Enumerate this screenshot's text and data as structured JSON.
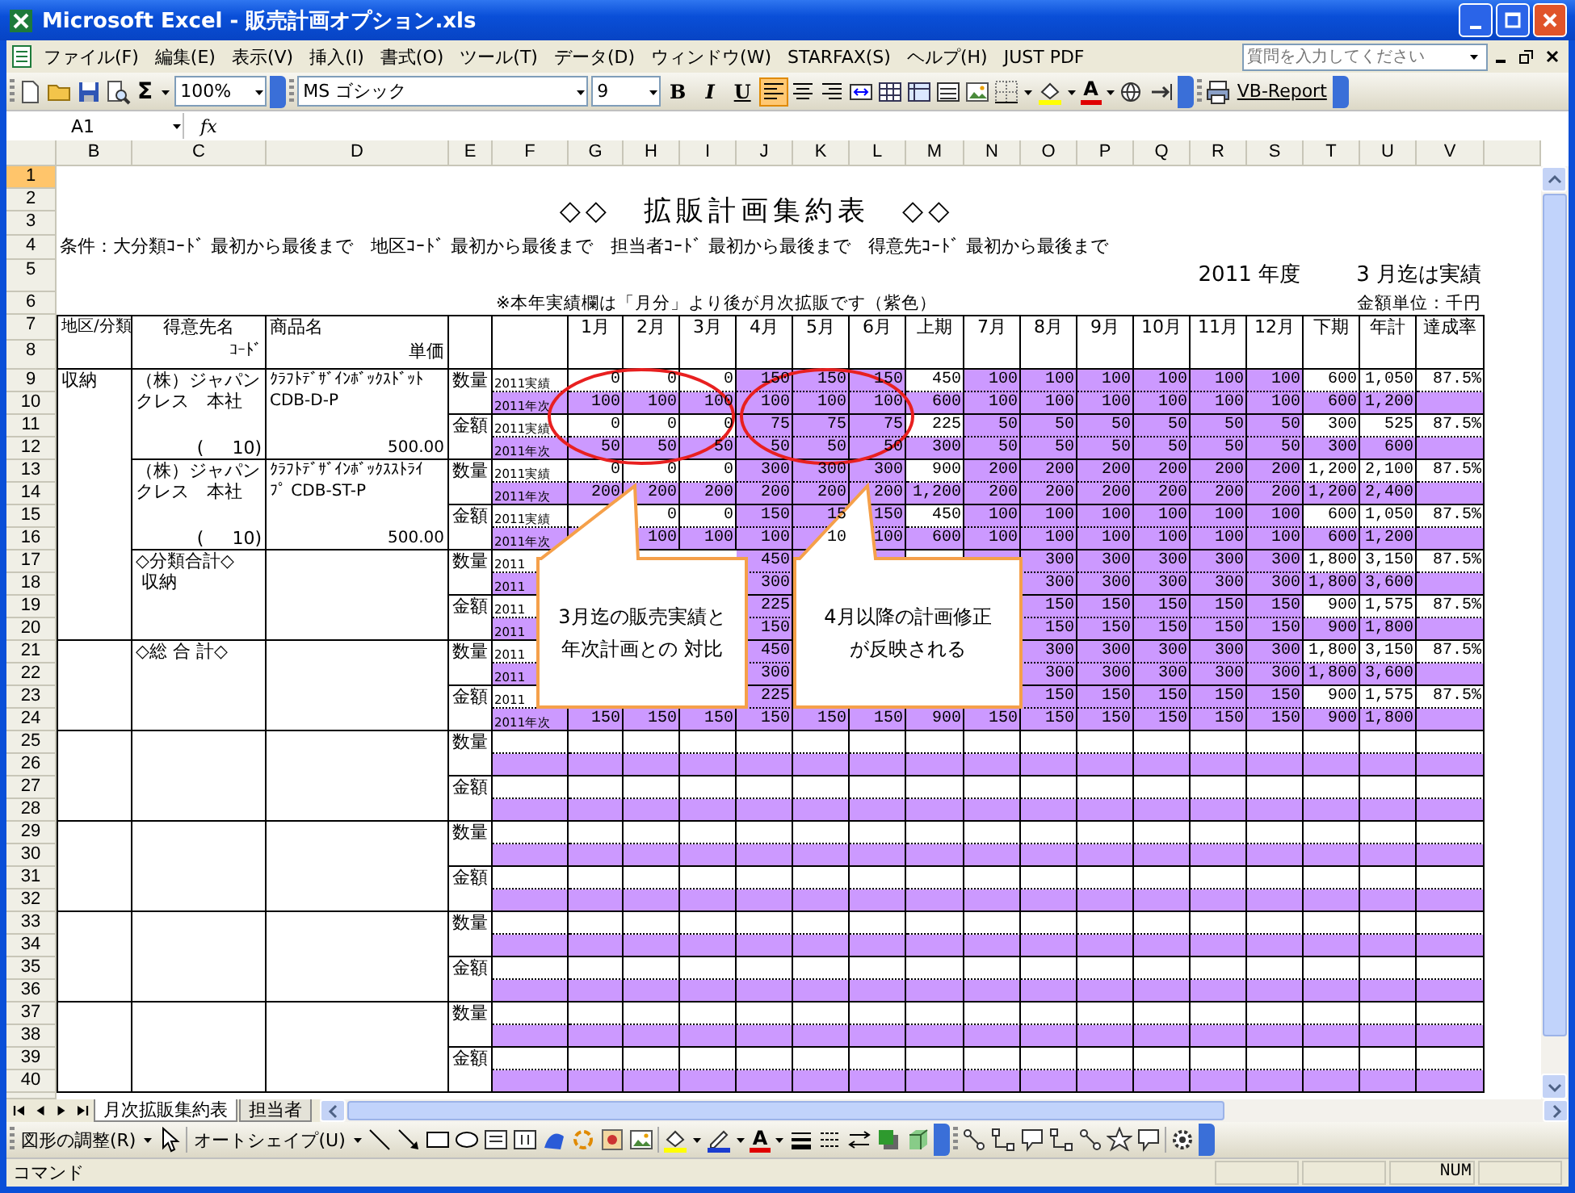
{
  "window": {
    "title": "Microsoft Excel - 販売計画オプション.xls"
  },
  "menu": [
    "ファイル(F)",
    "編集(E)",
    "表示(V)",
    "挿入(I)",
    "書式(O)",
    "ツール(T)",
    "データ(D)",
    "ウィンドウ(W)",
    "STARFAX(S)",
    "ヘルプ(H)",
    "JUST PDF"
  ],
  "help_search": {
    "placeholder": "質問を入力してください"
  },
  "toolbar": {
    "sum": "Σ",
    "zoom": "100%",
    "font": "MS ゴシック",
    "size": "9",
    "format_buttons": [
      "B",
      "I",
      "U"
    ],
    "align_buttons": [
      {
        "selected": true
      },
      {
        "selected": false
      },
      {
        "selected": false
      }
    ],
    "font_color": "A",
    "report_button": "VB-Report"
  },
  "formula_bar": {
    "name_box": "A1",
    "function_label": "fx"
  },
  "sheet": {
    "columns": [
      "B",
      "C",
      "D",
      "E",
      "F",
      "G",
      "H",
      "I",
      "J",
      "K",
      "L",
      "M",
      "N",
      "O",
      "P",
      "Q",
      "R",
      "S",
      "T",
      "U",
      "V"
    ],
    "rows": [
      {
        "label": "1",
        "selected": true
      },
      {
        "label": "2",
        "selected": false
      },
      {
        "label": "3",
        "selected": false
      },
      {
        "label": "4",
        "selected": false
      },
      {
        "label": "5",
        "selected": false
      },
      {
        "label": "6",
        "selected": false
      },
      {
        "label": "7",
        "selected": false
      },
      {
        "label": "8",
        "selected": false
      },
      {
        "label": "9",
        "selected": false
      },
      {
        "label": "10",
        "selected": false
      },
      {
        "label": "11",
        "selected": false
      },
      {
        "label": "12",
        "selected": false
      },
      {
        "label": "13",
        "selected": false
      },
      {
        "label": "14",
        "selected": false
      },
      {
        "label": "15",
        "selected": false
      },
      {
        "label": "16",
        "selected": false
      },
      {
        "label": "17",
        "selected": false
      },
      {
        "label": "18",
        "selected": false
      },
      {
        "label": "19",
        "selected": false
      },
      {
        "label": "20",
        "selected": false
      },
      {
        "label": "21",
        "selected": false
      },
      {
        "label": "22",
        "selected": false
      },
      {
        "label": "23",
        "selected": false
      },
      {
        "label": "24",
        "selected": false
      },
      {
        "label": "25",
        "selected": false
      },
      {
        "label": "26",
        "selected": false
      },
      {
        "label": "27",
        "selected": false
      },
      {
        "label": "28",
        "selected": false
      },
      {
        "label": "29",
        "selected": false
      },
      {
        "label": "30",
        "selected": false
      },
      {
        "label": "31",
        "selected": false
      },
      {
        "label": "32",
        "selected": false
      },
      {
        "label": "33",
        "selected": false
      },
      {
        "label": "34",
        "selected": false
      },
      {
        "label": "35",
        "selected": false
      },
      {
        "label": "36",
        "selected": false
      },
      {
        "label": "37",
        "selected": false
      },
      {
        "label": "38",
        "selected": false
      },
      {
        "label": "39",
        "selected": false
      },
      {
        "label": "40",
        "selected": false
      }
    ],
    "title": "◇◇　拡販計画集約表　◇◇",
    "conditions": "条件：大分類ｺｰﾄﾞ 最初から最後まで　地区ｺｰﾄﾞ 最初から最後まで　担当者ｺｰﾄﾞ 最初から最後まで　得意先ｺｰﾄﾞ 最初から最後まで",
    "fiscal_year": "2011 年度",
    "actual_until": "3 月迄は実績",
    "note": "※本年実績欄は「月分」より後が月次拡販です（紫色）",
    "unit": "金額単位：千円",
    "header": {
      "region": "地区/分類",
      "customer": "得意先名",
      "code": "ｺｰﾄﾞ",
      "product": "商品名",
      "price": "単価"
    },
    "months": [
      {
        "label": "1月",
        "forecast": false
      },
      {
        "label": "2月",
        "forecast": false
      },
      {
        "label": "3月",
        "forecast": false
      },
      {
        "label": "4月",
        "forecast": true
      },
      {
        "label": "5月",
        "forecast": true
      },
      {
        "label": "6月",
        "forecast": true
      },
      {
        "label": "上期",
        "forecast": false
      },
      {
        "label": "7月",
        "forecast": true
      },
      {
        "label": "8月",
        "forecast": true
      },
      {
        "label": "9月",
        "forecast": true
      },
      {
        "label": "10月",
        "forecast": true
      },
      {
        "label": "11月",
        "forecast": true
      },
      {
        "label": "12月",
        "forecast": true
      },
      {
        "label": "下期",
        "forecast": false
      },
      {
        "label": "年計",
        "forecast": false
      },
      {
        "label": "達成率",
        "forecast": false
      }
    ],
    "sections": [
      {
        "region": "収納",
        "groups": [
          {
            "customer": [
              "（株）ジャパン",
              "クレス　本社"
            ],
            "code": "(     10)",
            "product": [
              "ｸﾗﾌﾄﾃﾞｻﾞｲﾝﾎﾞｯｸｽﾄﾞｯﾄ",
              "CDB-D-P"
            ],
            "price": "500.00",
            "measures": [
              {
                "label": "数量",
                "rows": [
                  {
                    "kind": "actual",
                    "label": "2011実績",
                    "cells": [
                      "0",
                      "0",
                      "0",
                      "150",
                      "150",
                      "150",
                      "450",
                      "100",
                      "100",
                      "100",
                      "100",
                      "100",
                      "100",
                      "600",
                      "1,050",
                      "87.5%"
                    ]
                  },
                  {
                    "kind": "plan",
                    "label": "2011年次",
                    "cells": [
                      "100",
                      "100",
                      "100",
                      "100",
                      "100",
                      "100",
                      "600",
                      "100",
                      "100",
                      "100",
                      "100",
                      "100",
                      "100",
                      "600",
                      "1,200",
                      null
                    ]
                  }
                ]
              },
              {
                "label": "金額",
                "rows": [
                  {
                    "kind": "actual",
                    "label": "2011実績",
                    "cells": [
                      "0",
                      "0",
                      "0",
                      "75",
                      "75",
                      "75",
                      "225",
                      "50",
                      "50",
                      "50",
                      "50",
                      "50",
                      "50",
                      "300",
                      "525",
                      "87.5%"
                    ]
                  },
                  {
                    "kind": "plan",
                    "label": "2011年次",
                    "cells": [
                      "50",
                      "50",
                      "50",
                      "50",
                      "50",
                      "50",
                      "300",
                      "50",
                      "50",
                      "50",
                      "50",
                      "50",
                      "50",
                      "300",
                      "600",
                      null
                    ]
                  }
                ]
              }
            ]
          },
          {
            "customer": [
              "（株）ジャパン",
              "クレス　本社"
            ],
            "code": "(     10)",
            "product": [
              "ｸﾗﾌﾄﾃﾞｻﾞｲﾝﾎﾞｯｸｽｽﾄﾗｲ",
              "ﾌﾟ CDB-ST-P"
            ],
            "price": "500.00",
            "measures": [
              {
                "label": "数量",
                "rows": [
                  {
                    "kind": "actual",
                    "label": "2011実績",
                    "cells": [
                      "0",
                      "0",
                      "0",
                      "300",
                      "300",
                      "300",
                      "900",
                      "200",
                      "200",
                      "200",
                      "200",
                      "200",
                      "200",
                      "1,200",
                      "2,100",
                      "87.5%"
                    ]
                  },
                  {
                    "kind": "plan",
                    "label": "2011年次",
                    "cells": [
                      "200",
                      "200",
                      "200",
                      "200",
                      "200",
                      "200",
                      "1,200",
                      "200",
                      "200",
                      "200",
                      "200",
                      "200",
                      "200",
                      "1,200",
                      "2,400",
                      null
                    ]
                  }
                ]
              },
              {
                "label": "金額",
                "rows": [
                  {
                    "kind": "actual",
                    "label": "2011実績",
                    "cells": [
                      null,
                      "0",
                      "0",
                      "150",
                      "15",
                      "150",
                      "450",
                      "100",
                      "100",
                      "100",
                      "100",
                      "100",
                      "100",
                      "600",
                      "1,050",
                      "87.5%"
                    ]
                  },
                  {
                    "kind": "plan",
                    "label": "2011年次",
                    "cells": [
                      null,
                      "100",
                      "100",
                      "100",
                      "10",
                      "100",
                      "600",
                      "100",
                      "100",
                      "100",
                      "100",
                      "100",
                      "100",
                      "600",
                      "1,200",
                      null
                    ]
                  }
                ]
              }
            ]
          },
          {
            "customer": [
              "◇分類合計◇",
              " 収納"
            ],
            "measures": [
              {
                "label": "数量",
                "rows": [
                  {
                    "kind": "actual",
                    "label": "2011",
                    "cells": [
                      null,
                      null,
                      null,
                      "450",
                      null,
                      null,
                      null,
                      null,
                      "300",
                      "300",
                      "300",
                      "300",
                      "300",
                      "1,800",
                      "3,150",
                      "87.5%"
                    ]
                  },
                  {
                    "kind": "plan",
                    "label": "2011",
                    "cells": [
                      null,
                      null,
                      null,
                      "300",
                      null,
                      null,
                      null,
                      null,
                      "300",
                      "300",
                      "300",
                      "300",
                      "300",
                      "1,800",
                      "3,600",
                      null
                    ]
                  }
                ]
              },
              {
                "label": "金額",
                "rows": [
                  {
                    "kind": "actual",
                    "label": "2011",
                    "cells": [
                      null,
                      null,
                      null,
                      "225",
                      null,
                      null,
                      null,
                      null,
                      "150",
                      "150",
                      "150",
                      "150",
                      "150",
                      "900",
                      "1,575",
                      "87.5%"
                    ]
                  },
                  {
                    "kind": "plan",
                    "label": "2011",
                    "cells": [
                      null,
                      null,
                      null,
                      "150",
                      null,
                      null,
                      null,
                      null,
                      "150",
                      "150",
                      "150",
                      "150",
                      "150",
                      "900",
                      "1,800",
                      null
                    ]
                  }
                ]
              }
            ]
          }
        ]
      },
      {
        "groups": [
          {
            "customer": [
              "◇総 合 計◇"
            ],
            "measures": [
              {
                "label": "数量",
                "rows": [
                  {
                    "kind": "actual",
                    "label": "2011",
                    "cells": [
                      null,
                      null,
                      null,
                      "450",
                      null,
                      null,
                      null,
                      null,
                      "300",
                      "300",
                      "300",
                      "300",
                      "300",
                      "1,800",
                      "3,150",
                      "87.5%"
                    ]
                  },
                  {
                    "kind": "plan",
                    "label": "2011",
                    "cells": [
                      null,
                      null,
                      null,
                      "300",
                      null,
                      null,
                      null,
                      null,
                      "300",
                      "300",
                      "300",
                      "300",
                      "300",
                      "1,800",
                      "3,600",
                      null
                    ]
                  }
                ]
              },
              {
                "label": "金額",
                "rows": [
                  {
                    "kind": "actual",
                    "label": "2011",
                    "cells": [
                      null,
                      null,
                      null,
                      "225",
                      null,
                      null,
                      null,
                      null,
                      "150",
                      "150",
                      "150",
                      "150",
                      "150",
                      "900",
                      "1,575",
                      "87.5%"
                    ]
                  },
                  {
                    "kind": "plan",
                    "label": "2011年次",
                    "cells": [
                      "150",
                      "150",
                      "150",
                      "150",
                      "150",
                      "150",
                      "900",
                      "150",
                      "150",
                      "150",
                      "150",
                      "150",
                      "150",
                      "900",
                      "1,800",
                      null
                    ]
                  }
                ]
              }
            ]
          }
        ]
      },
      {
        "groups": [
          {
            "measures": [
              {
                "label": "数量",
                "rows": [
                  {
                    "kind": "empty"
                  },
                  {
                    "kind": "plan"
                  }
                ]
              },
              {
                "label": "金額",
                "rows": [
                  {
                    "kind": "empty"
                  },
                  {
                    "kind": "plan"
                  }
                ]
              }
            ]
          }
        ]
      },
      {
        "groups": [
          {
            "measures": [
              {
                "label": "数量",
                "rows": [
                  {
                    "kind": "empty"
                  },
                  {
                    "kind": "plan"
                  }
                ]
              },
              {
                "label": "金額",
                "rows": [
                  {
                    "kind": "empty"
                  },
                  {
                    "kind": "plan"
                  }
                ]
              }
            ]
          }
        ]
      },
      {
        "groups": [
          {
            "measures": [
              {
                "label": "数量",
                "rows": [
                  {
                    "kind": "empty"
                  },
                  {
                    "kind": "plan"
                  }
                ]
              },
              {
                "label": "金額",
                "rows": [
                  {
                    "kind": "empty"
                  },
                  {
                    "kind": "plan"
                  }
                ]
              }
            ]
          }
        ]
      },
      {
        "groups": [
          {
            "measures": [
              {
                "label": "数量",
                "rows": [
                  {
                    "kind": "empty"
                  },
                  {
                    "kind": "plan"
                  }
                ]
              },
              {
                "label": "金額",
                "rows": [
                  {
                    "kind": "empty"
                  },
                  {
                    "kind": "plan"
                  }
                ]
              }
            ]
          }
        ]
      }
    ],
    "callouts": [
      {
        "lines": [
          "3月迄の販売実績と",
          "年次計画との 対比"
        ]
      },
      {
        "lines": [
          "4月以降の計画修正",
          "が反映される"
        ]
      }
    ]
  },
  "sheet_tabs": [
    {
      "label": "月次拡販集約表",
      "selected": true
    },
    {
      "label": "担当者",
      "selected": false
    }
  ],
  "drawing_toolbar": {
    "arrange": "図形の調整(R)",
    "autoshapes": "オートシェイプ(U)",
    "font_color": "A"
  },
  "status_bar": {
    "mode": "コマンド",
    "num_lock": "NUM"
  }
}
